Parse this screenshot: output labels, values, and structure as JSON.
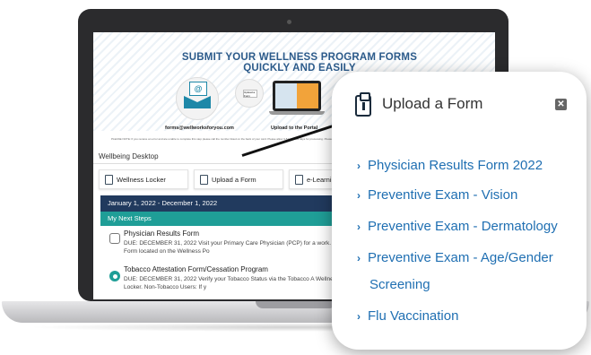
{
  "screen": {
    "headline": "SUBMIT YOUR WELLNESS PROGRAM FORMS QUICKLY AND EASILY",
    "email_option": "forms@wellworksforyou.com",
    "portal_option": "Upload to the Portal",
    "mini_doc_label": "Upload a Form",
    "fine_print": "PLEASE NOTE: If you receive an error and are unable to complete this step please call the number listed on the back of your card. Please allow 3-5 business days for processing. Please keep a copy of your form for your records.",
    "wellbeing_title": "Wellbeing Desktop",
    "tiles": [
      "Wellness Locker",
      "Upload a Form",
      "e-Learning"
    ],
    "date_range": "January 1, 2022 - December 1, 2022",
    "steps_title": "My Next Steps",
    "steps": [
      {
        "title": "Physician Results Form",
        "desc": "DUE: DECEMBER 31, 2022 Visit your Primary Care Physician (PCP) for a work. Print out the Physician Results Form located on the Wellness Po"
      },
      {
        "title": "Tobacco Attestation Form/Cessation Program",
        "desc": "DUE: DECEMBER 31, 2022 Verify your Tobacco Status via the Tobacco A Wellness Portal under Menu>Wellness Locker. Non-Tobacco Users: If y"
      }
    ]
  },
  "popup": {
    "title": "Upload a Form",
    "close_symbol": "✕",
    "icon": "clipboard-upload-icon",
    "forms": [
      "Physician Results Form 2022",
      "Preventive Exam - Vision",
      "Preventive Exam - Dermatology",
      "Preventive Exam - Age/Gender",
      "Flu Vaccination"
    ],
    "form_continuation": "Screening",
    "chevron": "›"
  },
  "colors": {
    "link": "#1f6fb2",
    "navy_bar": "#213a5e",
    "teal_bar": "#1f9e97",
    "headline": "#2b5a8a"
  }
}
